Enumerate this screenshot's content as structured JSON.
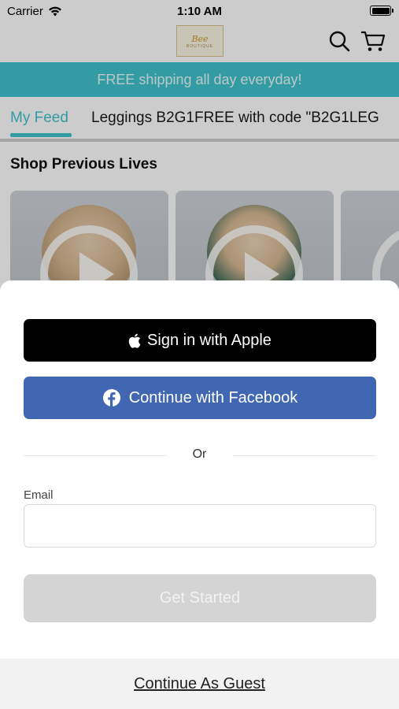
{
  "status_bar": {
    "carrier": "Carrier",
    "time": "1:10 AM",
    "icons": [
      "wifi-icon",
      "battery-icon"
    ]
  },
  "header": {
    "logo_text": "Bee",
    "logo_sub": "BOUTIQUE",
    "icons": [
      "search-icon",
      "cart-icon"
    ]
  },
  "promo_banner": {
    "text": "FREE shipping all day everyday!",
    "color": "#3fc2cc"
  },
  "feed_tabs": [
    {
      "label": "My Feed",
      "active": true
    },
    {
      "label": "Leggings B2G1FREE with code \"B2G1LEG"
    }
  ],
  "section": {
    "title": "Shop Previous Lives"
  },
  "login_sheet": {
    "apple_button": "Sign in with Apple",
    "facebook_button": "Continue with Facebook",
    "or_text": "Or",
    "email_label": "Email",
    "email_value": "",
    "email_placeholder": "",
    "get_started_button": "Get Started",
    "guest_link": "Continue As Guest"
  },
  "colors": {
    "accent": "#3fc2cc",
    "facebook": "#4267b2",
    "apple": "#000000",
    "disabled_button": "#d4d4d4"
  }
}
